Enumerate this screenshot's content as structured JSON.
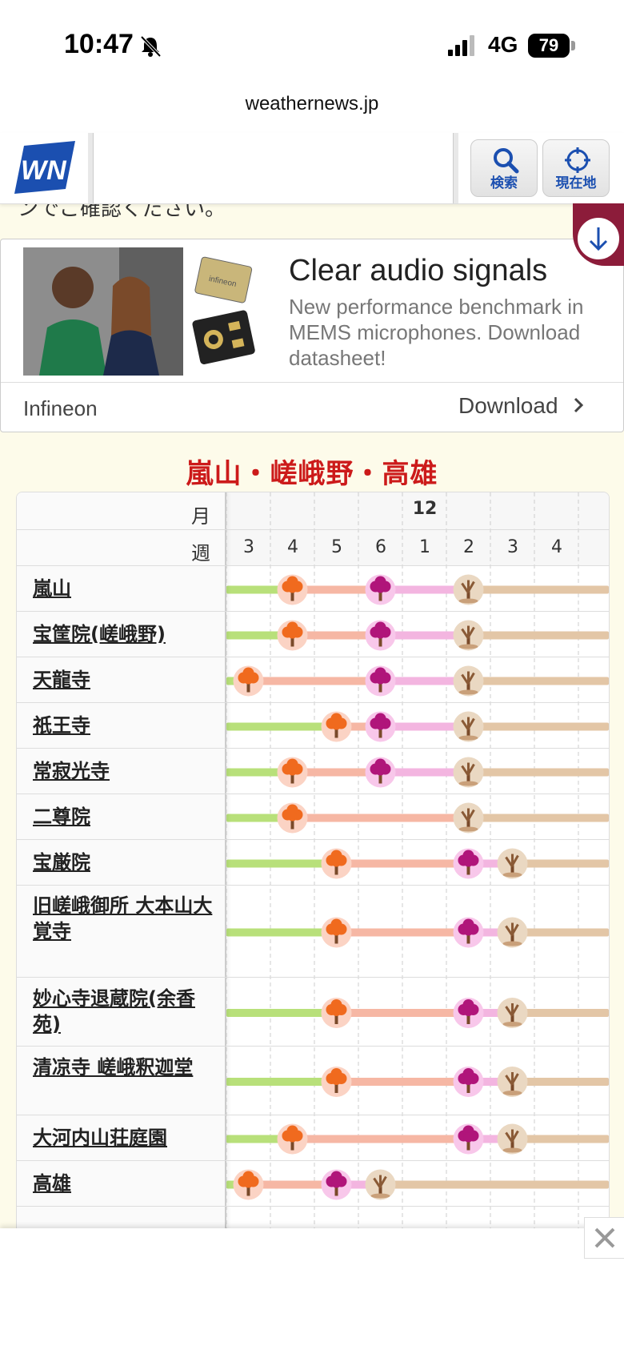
{
  "status_bar": {
    "time": "10:47",
    "network": "4G",
    "battery": "79"
  },
  "browser": {
    "url": "weathernews.jp"
  },
  "header": {
    "logo": "WN",
    "search_label": "検索",
    "location_label": "現在地"
  },
  "cut_text": "ンでご確認ください。",
  "ad": {
    "title": "Clear audio signals",
    "subtitle": "New performance benchmark in MEMS microphones. Download datasheet!",
    "brand": "Infineon",
    "cta": "Download"
  },
  "section": {
    "title": "嵐山・嵯峨野・高雄",
    "month_header": "月",
    "week_header": "週",
    "month_value": "12",
    "weeks": [
      "3",
      "4",
      "5",
      "6",
      "1",
      "2",
      "3",
      "4"
    ],
    "spots": [
      {
        "name": "嵐山",
        "stage_start": 1,
        "peak": 1,
        "leaves_fall": 3,
        "bare": 5
      },
      {
        "name": "宝筐院(嵯峨野)",
        "stage_start": 1,
        "peak": 1,
        "leaves_fall": 3,
        "bare": 5
      },
      {
        "name": "天龍寺",
        "stage_start": 0,
        "peak": 0,
        "leaves_fall": 3,
        "bare": 5
      },
      {
        "name": "祇王寺",
        "stage_start": 2,
        "peak": 2,
        "leaves_fall": 3,
        "bare": 5
      },
      {
        "name": "常寂光寺",
        "stage_start": 1,
        "peak": 1,
        "leaves_fall": 3,
        "bare": 5
      },
      {
        "name": "二尊院",
        "stage_start": 1,
        "peak": 1,
        "leaves_fall": null,
        "bare": 5
      },
      {
        "name": "宝厳院",
        "stage_start": 2,
        "peak": 2,
        "leaves_fall": 5,
        "bare": 6
      },
      {
        "name": "旧嵯峨御所 大本山大覚寺",
        "stage_start": 2,
        "peak": 2,
        "leaves_fall": 5,
        "bare": 6
      },
      {
        "name": "妙心寺退蔵院(余香苑)",
        "stage_start": 2,
        "peak": 2,
        "leaves_fall": 5,
        "bare": 6
      },
      {
        "name": "清凉寺 嵯峨釈迦堂",
        "stage_start": 2,
        "peak": 2,
        "leaves_fall": 5,
        "bare": 6
      },
      {
        "name": "大河内山荘庭園",
        "stage_start": 1,
        "peak": 1,
        "leaves_fall": 5,
        "bare": 6
      },
      {
        "name": "高雄",
        "stage_start": 0,
        "peak": 0,
        "leaves_fall": 2,
        "bare": 3
      }
    ]
  },
  "colors": {
    "green": "#b8e07a",
    "salmon": "#f6b7a4",
    "pink": "#f3b5e0",
    "tan": "#e3c6a6",
    "title_red": "#cc1a1a",
    "brand_blue": "#1b4fb0"
  }
}
